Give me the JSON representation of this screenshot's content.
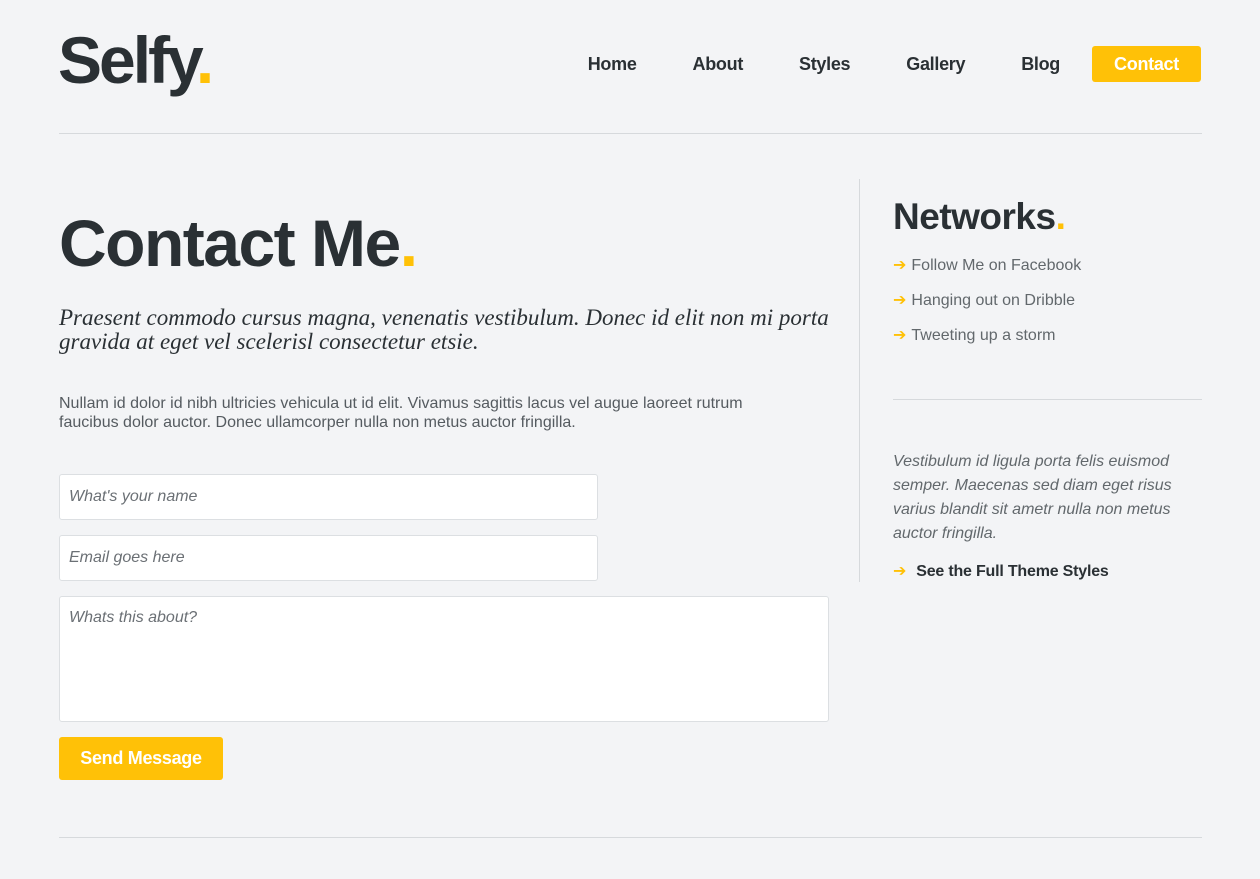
{
  "brand": {
    "name": "Selfy",
    "dot": ".",
    "accent": "#ffc107",
    "text_color": "#2a3034"
  },
  "nav": {
    "links": [
      "Home",
      "About",
      "Styles",
      "Gallery",
      "Blog"
    ],
    "cta": "Contact"
  },
  "main": {
    "title": "Contact Me",
    "title_dot": ".",
    "lead": "Praesent commodo cursus magna, venenatis vestibulum. Donec id elit non mi porta gravida at eget vel scelerisl consectetur etsie.",
    "body": "Nullam id dolor id nibh ultricies vehicula ut id elit. Vivamus sagittis lacus vel augue laoreet rutrum faucibus dolor auctor. Donec ullamcorper nulla non metus auctor fringilla.",
    "form": {
      "name_placeholder": "What's your name",
      "email_placeholder": "Email goes here",
      "message_placeholder": "Whats this about?",
      "submit_label": "Send Message"
    }
  },
  "sidebar": {
    "title": "Networks",
    "title_dot": ".",
    "arrow_icon": "right-arrow-icon",
    "arrow_glyph": "➔",
    "links": [
      "Follow Me on Facebook",
      "Hanging out on Dribble",
      "Tweeting up a storm"
    ],
    "quote": "Vestibulum id ligula porta felis euismod semper. Maecenas sed diam eget risus varius blandit sit ametr nulla non metus auctor fringilla.",
    "cta": "See the Full Theme Styles"
  }
}
